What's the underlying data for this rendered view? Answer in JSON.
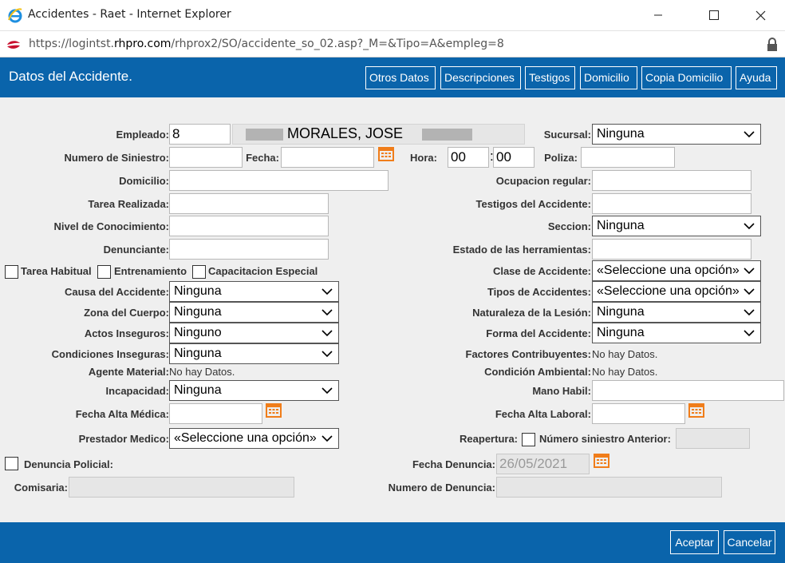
{
  "window": {
    "title": "Accidentes - Raet - Internet Explorer",
    "url": "https://logintst.rhpro.com/rhprox2/SO/accidente_so_02.asp?_M=&Tipo=A&empleg=8",
    "url_parts": [
      "https://logintst.",
      "rhpro.com",
      "/rhprox2/SO/accidente_so_02.asp?_M=&Tipo=A&empleg=8"
    ]
  },
  "header": {
    "title": "Datos del Accidente.",
    "buttons": [
      "Otros Datos",
      "Descripciones",
      "Testigos",
      "Domicilio",
      "Copia Domicilio",
      "Ayuda"
    ]
  },
  "form": {
    "empleado": {
      "label": "Empleado:",
      "value": "8",
      "name": "MORALES, JOSE"
    },
    "sucursal": {
      "label": "Sucursal:",
      "value": "Ninguna"
    },
    "siniestro": {
      "label": "Numero de Siniestro:",
      "value": ""
    },
    "fecha": {
      "label": "Fecha:",
      "value": ""
    },
    "hora": {
      "label": "Hora:",
      "hh": "00",
      "mm": "00",
      "sep": ":"
    },
    "poliza": {
      "label": "Poliza:",
      "value": ""
    },
    "domicilio": {
      "label": "Domicilio:",
      "value": ""
    },
    "ocupacion": {
      "label": "Ocupacion regular:",
      "value": ""
    },
    "tarea": {
      "label": "Tarea Realizada:",
      "value": ""
    },
    "testigos": {
      "label": "Testigos del Accidente:",
      "value": ""
    },
    "nivel": {
      "label": "Nivel de Conocimiento:",
      "value": ""
    },
    "seccion": {
      "label": "Seccion:",
      "value": "Ninguna"
    },
    "denunciante": {
      "label": "Denunciante:",
      "value": ""
    },
    "herramientas": {
      "label": "Estado de las herramientas:",
      "value": ""
    },
    "checks": {
      "tarea_habitual": "Tarea Habitual",
      "entrenamiento": "Entrenamiento",
      "capacitacion": "Capacitacion Especial"
    },
    "clase": {
      "label": "Clase de Accidente:",
      "value": "«Seleccione una opción»"
    },
    "causa": {
      "label": "Causa del Accidente:",
      "value": "Ninguna"
    },
    "tipos": {
      "label": "Tipos de Accidentes:",
      "value": "«Seleccione una opción»"
    },
    "zona": {
      "label": "Zona del Cuerpo:",
      "value": "Ninguna"
    },
    "naturaleza": {
      "label": "Naturaleza de la Lesión:",
      "value": "Ninguna"
    },
    "actos": {
      "label": "Actos Inseguros:",
      "value": "Ninguno"
    },
    "forma": {
      "label": "Forma del Accidente:",
      "value": "Ninguna"
    },
    "condiciones": {
      "label": "Condiciones Inseguras:",
      "value": "Ninguna"
    },
    "factores": {
      "label": "Factores Contribuyentes:",
      "value": "No hay Datos."
    },
    "agente": {
      "label": "Agente Material:",
      "value": "No hay Datos."
    },
    "condicion_amb": {
      "label": "Condición Ambiental:",
      "value": "No hay Datos."
    },
    "incapacidad": {
      "label": "Incapacidad:",
      "value": "Ninguna"
    },
    "mano": {
      "label": "Mano Habil:",
      "value": ""
    },
    "alta_medica": {
      "label": "Fecha Alta Médica:",
      "value": ""
    },
    "alta_laboral": {
      "label": "Fecha Alta Laboral:",
      "value": ""
    },
    "prestador": {
      "label": "Prestador Medico:",
      "value": "«Seleccione una opción»"
    },
    "reapertura": {
      "label": "Reapertura:",
      "nro_label": "Número siniestro Anterior:",
      "value": ""
    },
    "denuncia_policial": {
      "label": "Denuncia Policial:"
    },
    "fecha_denuncia": {
      "label": "Fecha Denuncia:",
      "value": "26/05/2021"
    },
    "comisaria": {
      "label": "Comisaria:",
      "value": ""
    },
    "nro_denuncia": {
      "label": "Numero de Denuncia:",
      "value": ""
    }
  },
  "footer": {
    "accept": "Aceptar",
    "cancel": "Cancelar"
  },
  "colors": {
    "header_bg": "#0a64ab",
    "calendar": "#f07d1a"
  }
}
